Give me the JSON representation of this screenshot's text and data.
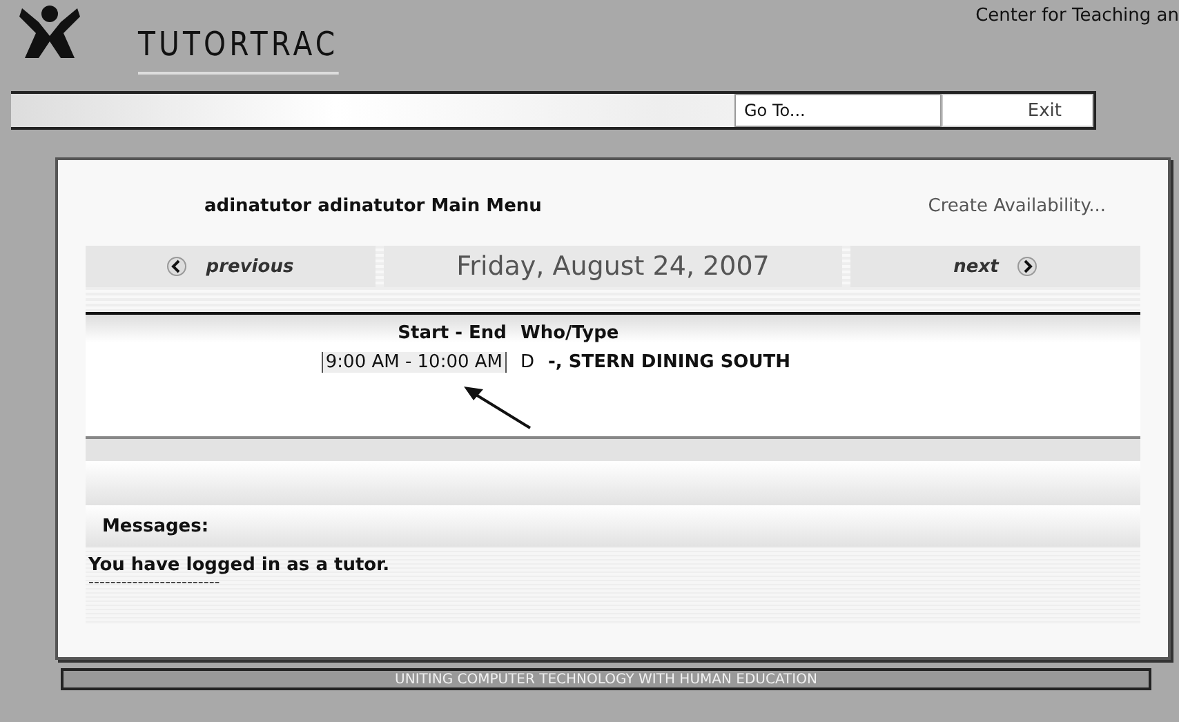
{
  "header": {
    "brand": "TUTORTRAC",
    "center_name": "Center for Teaching an"
  },
  "toolbar": {
    "goto": {
      "placeholder": "Go To..."
    },
    "exit": "Exit"
  },
  "main": {
    "title": "adinatutor adinatutor Main Menu",
    "create_link": "Create Availability...",
    "nav": {
      "previous": "previous",
      "date": "Friday, August 24, 2007",
      "next": "next"
    },
    "table": {
      "columns": [
        "Start - End",
        "Who/Type"
      ],
      "rows": [
        {
          "time": "9:00 AM - 10:00 AM",
          "type": "D",
          "who": "-, STERN DINING SOUTH"
        }
      ]
    },
    "messages": {
      "label": "Messages:",
      "text": "You have logged in as a tutor.",
      "rule": "------------------------"
    }
  },
  "footer": "UNITING COMPUTER TECHNOLOGY WITH HUMAN EDUCATION"
}
